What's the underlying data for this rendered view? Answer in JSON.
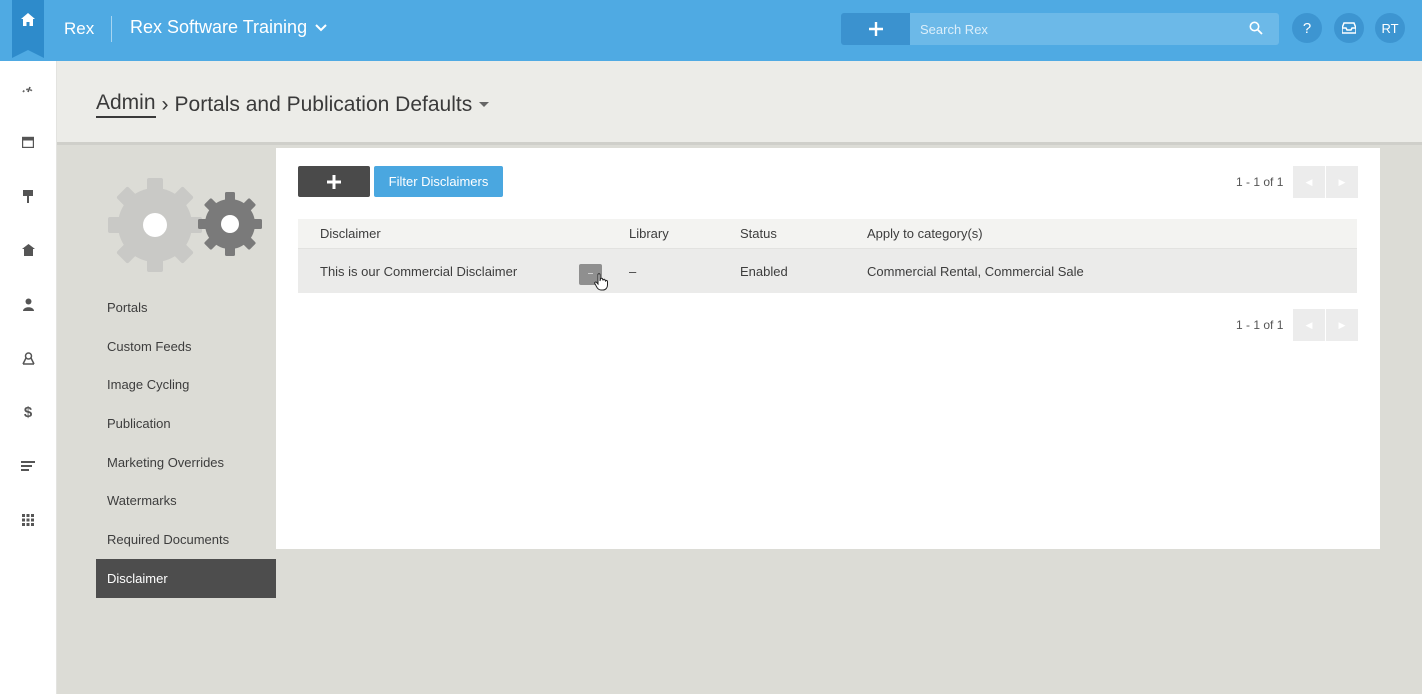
{
  "topbar": {
    "brand": "Rex",
    "account_name": "Rex Software Training",
    "search_placeholder": "Search Rex",
    "help_label": "?",
    "avatar_initials": "RT",
    "color": "#4faae3"
  },
  "breadcrumb": {
    "parent": "Admin",
    "separator": "›",
    "current": "Portals and Publication Defaults"
  },
  "sidebar": {
    "items": [
      {
        "label": "Portals"
      },
      {
        "label": "Custom Feeds"
      },
      {
        "label": "Image Cycling"
      },
      {
        "label": "Publication"
      },
      {
        "label": "Marketing Overrides"
      },
      {
        "label": "Watermarks"
      },
      {
        "label": "Required Documents"
      },
      {
        "label": "Disclaimer",
        "active": true
      }
    ]
  },
  "toolbar": {
    "filter_label": "Filter Disclaimers"
  },
  "pagination": {
    "top": "1 - 1 of 1",
    "bottom": "1 - 1 of 1"
  },
  "table": {
    "columns": [
      "Disclaimer",
      "Library",
      "Status",
      "Apply to category(s)"
    ],
    "rows": [
      {
        "disclaimer": "This is our Commercial Disclaimer",
        "library": "–",
        "status": "Enabled",
        "categories": "Commercial Rental, Commercial Sale"
      }
    ]
  }
}
